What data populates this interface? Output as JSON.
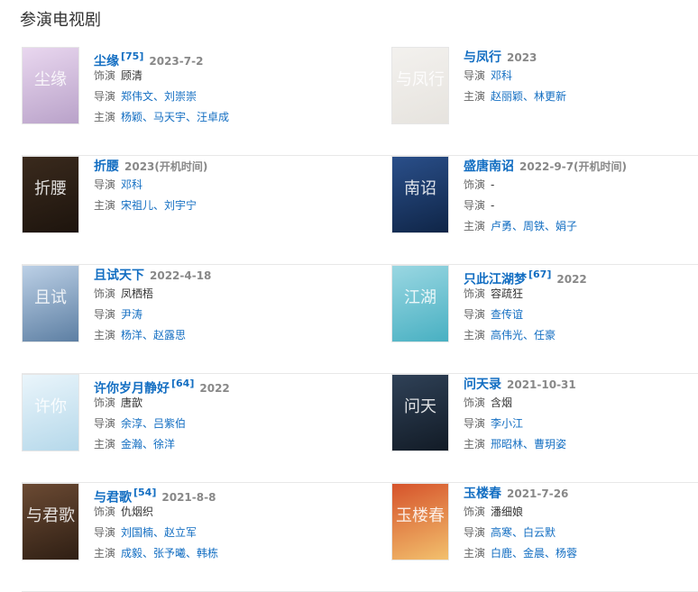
{
  "section_title": "参演电视剧",
  "labels": {
    "role": "饰演",
    "director": "导演",
    "cast": "主演"
  },
  "dramas": [
    {
      "title": "尘缘",
      "cite": "[75]",
      "date": "2023-7-2",
      "role": "顾清",
      "director": "郑伟文、刘崇崇",
      "cast": "杨颖、马天宇、汪卓成",
      "poster_colors": [
        "#e9d7ef",
        "#b9a2c9"
      ],
      "poster_glyph": "尘缘"
    },
    {
      "title": "与凤行",
      "cite": "",
      "date": "2023",
      "role": "",
      "director": "邓科",
      "cast": "赵丽颖、林更新",
      "poster_colors": [
        "#f3f1ee",
        "#e6e3de"
      ],
      "poster_glyph": "与凤行"
    },
    {
      "title": "折腰",
      "cite": "",
      "date": "2023(开机时间)",
      "role": "",
      "director": "邓科",
      "cast": "宋祖儿、刘宇宁",
      "poster_colors": [
        "#3a2a1d",
        "#1d140d"
      ],
      "poster_glyph": "折腰"
    },
    {
      "title": "盛唐南诏",
      "cite": "",
      "date": "2022-9-7(开机时间)",
      "role": "-",
      "director": "-",
      "cast": "卢勇、周铁、娟子",
      "poster_colors": [
        "#2a4f8a",
        "#0f2547"
      ],
      "poster_glyph": "南诏"
    },
    {
      "title": "且试天下",
      "cite": "",
      "date": "2022-4-18",
      "role": "凤栖梧",
      "director": "尹涛",
      "cast": "杨洋、赵露思",
      "poster_colors": [
        "#bcd0e6",
        "#5d7fa3"
      ],
      "poster_glyph": "且试"
    },
    {
      "title": "只此江湖梦",
      "cite": "[67]",
      "date": "2022",
      "role": "容疏狂",
      "director": "查传谊",
      "cast": "高伟光、任豪",
      "poster_colors": [
        "#9ad7e2",
        "#48b0c2"
      ],
      "poster_glyph": "江湖"
    },
    {
      "title": "许你岁月静好",
      "cite": "[64]",
      "date": "2022",
      "role": "唐歆",
      "director": "余淳、吕紫伯",
      "cast": "金瀚、徐洋",
      "poster_colors": [
        "#eaf5fb",
        "#b5d8ea"
      ],
      "poster_glyph": "许你"
    },
    {
      "title": "问天录",
      "cite": "",
      "date": "2021-10-31",
      "role": "含烟",
      "director": "李小江",
      "cast": "邢昭林、曹玥姿",
      "poster_colors": [
        "#2f4157",
        "#121b26"
      ],
      "poster_glyph": "问天"
    },
    {
      "title": "与君歌",
      "cite": "[54]",
      "date": "2021-8-8",
      "role": "仇烟织",
      "director": "刘国楠、赵立军",
      "cast": "成毅、张予曦、韩栋",
      "poster_colors": [
        "#6b4a33",
        "#2f1f14"
      ],
      "poster_glyph": "与君歌"
    },
    {
      "title": "玉楼春",
      "cite": "",
      "date": "2021-7-26",
      "role": "潘细娘",
      "director": "高寒、白云默",
      "cast": "白鹿、金晨、杨蓉",
      "poster_colors": [
        "#d6532b",
        "#f2c06d"
      ],
      "poster_glyph": "玉楼春"
    }
  ]
}
